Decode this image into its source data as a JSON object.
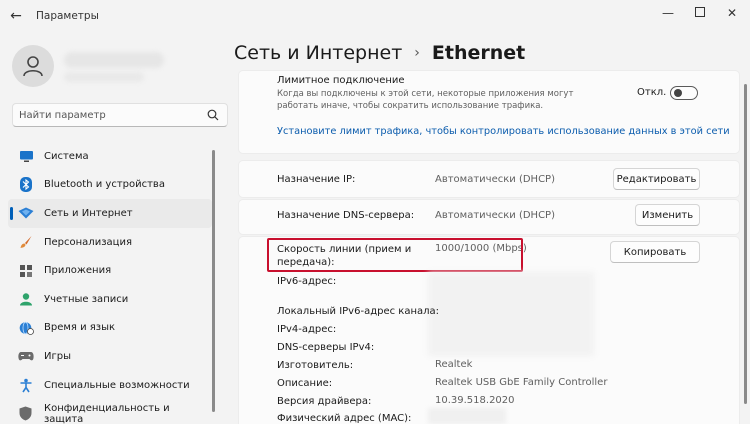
{
  "window": {
    "title": "Параметры"
  },
  "sidebar": {
    "search_placeholder": "Найти параметр",
    "items": [
      {
        "label": "Система",
        "icon": "monitor-icon"
      },
      {
        "label": "Bluetooth и устройства",
        "icon": "bluetooth-icon"
      },
      {
        "label": "Сеть и Интернет",
        "icon": "network-icon",
        "active": true
      },
      {
        "label": "Персонализация",
        "icon": "brush-icon"
      },
      {
        "label": "Приложения",
        "icon": "apps-icon"
      },
      {
        "label": "Учетные записи",
        "icon": "person-icon"
      },
      {
        "label": "Время и язык",
        "icon": "globe-clock-icon"
      },
      {
        "label": "Игры",
        "icon": "gamepad-icon"
      },
      {
        "label": "Специальные возможности",
        "icon": "accessibility-icon"
      },
      {
        "label": "Конфиденциальность и защита",
        "icon": "shield-icon"
      }
    ]
  },
  "header": {
    "breadcrumb_parent": "Сеть и Интернет",
    "breadcrumb_current": "Ethernet"
  },
  "metered": {
    "title": "Лимитное подключение",
    "description_line1": "Когда вы подключены к этой сети, некоторые приложения могут",
    "description_line2": "работать иначе, чтобы сократить использование трафика.",
    "toggle_label": "Откл.",
    "toggle_on": false,
    "link": "Установите лимит трафика, чтобы контролировать использование данных в этой сети"
  },
  "ip_assignment": {
    "label": "Назначение IP:",
    "value": "Автоматически (DHCP)",
    "button": "Редактировать"
  },
  "dns_assignment": {
    "label": "Назначение DNS-сервера:",
    "value": "Автоматически (DHCP)",
    "button": "Изменить"
  },
  "properties": {
    "copy_button": "Копировать",
    "link_speed_label_line1": "Скорость линии (прием и",
    "link_speed_label_line2": "передача):",
    "link_speed_value": "1000/1000 (Mbps)",
    "ipv6_label": "IPv6-адрес:",
    "link_local_ipv6_label": "Локальный IPv6-адрес канала:",
    "ipv4_label": "IPv4-адрес:",
    "dns_ipv4_label": "DNS-серверы IPv4:",
    "manufacturer_label": "Изготовитель:",
    "manufacturer_value": "Realtek",
    "description_label": "Описание:",
    "description_value": "Realtek USB GbE Family Controller",
    "driver_label": "Версия драйвера:",
    "driver_value": "10.39.518.2020",
    "mac_label": "Физический адрес (MAC):"
  },
  "colors": {
    "accent": "#005fb8",
    "link": "#0b5cad",
    "highlight": "#c8102e"
  }
}
